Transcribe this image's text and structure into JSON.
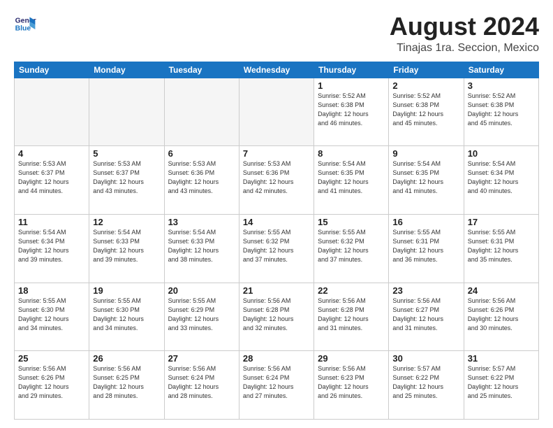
{
  "header": {
    "logo_line1": "General",
    "logo_line2": "Blue",
    "month": "August 2024",
    "location": "Tinajas 1ra. Seccion, Mexico"
  },
  "days_of_week": [
    "Sunday",
    "Monday",
    "Tuesday",
    "Wednesday",
    "Thursday",
    "Friday",
    "Saturday"
  ],
  "weeks": [
    [
      {
        "day": "",
        "info": ""
      },
      {
        "day": "",
        "info": ""
      },
      {
        "day": "",
        "info": ""
      },
      {
        "day": "",
        "info": ""
      },
      {
        "day": "1",
        "info": "Sunrise: 5:52 AM\nSunset: 6:38 PM\nDaylight: 12 hours\nand 46 minutes."
      },
      {
        "day": "2",
        "info": "Sunrise: 5:52 AM\nSunset: 6:38 PM\nDaylight: 12 hours\nand 45 minutes."
      },
      {
        "day": "3",
        "info": "Sunrise: 5:52 AM\nSunset: 6:38 PM\nDaylight: 12 hours\nand 45 minutes."
      }
    ],
    [
      {
        "day": "4",
        "info": "Sunrise: 5:53 AM\nSunset: 6:37 PM\nDaylight: 12 hours\nand 44 minutes."
      },
      {
        "day": "5",
        "info": "Sunrise: 5:53 AM\nSunset: 6:37 PM\nDaylight: 12 hours\nand 43 minutes."
      },
      {
        "day": "6",
        "info": "Sunrise: 5:53 AM\nSunset: 6:36 PM\nDaylight: 12 hours\nand 43 minutes."
      },
      {
        "day": "7",
        "info": "Sunrise: 5:53 AM\nSunset: 6:36 PM\nDaylight: 12 hours\nand 42 minutes."
      },
      {
        "day": "8",
        "info": "Sunrise: 5:54 AM\nSunset: 6:35 PM\nDaylight: 12 hours\nand 41 minutes."
      },
      {
        "day": "9",
        "info": "Sunrise: 5:54 AM\nSunset: 6:35 PM\nDaylight: 12 hours\nand 41 minutes."
      },
      {
        "day": "10",
        "info": "Sunrise: 5:54 AM\nSunset: 6:34 PM\nDaylight: 12 hours\nand 40 minutes."
      }
    ],
    [
      {
        "day": "11",
        "info": "Sunrise: 5:54 AM\nSunset: 6:34 PM\nDaylight: 12 hours\nand 39 minutes."
      },
      {
        "day": "12",
        "info": "Sunrise: 5:54 AM\nSunset: 6:33 PM\nDaylight: 12 hours\nand 39 minutes."
      },
      {
        "day": "13",
        "info": "Sunrise: 5:54 AM\nSunset: 6:33 PM\nDaylight: 12 hours\nand 38 minutes."
      },
      {
        "day": "14",
        "info": "Sunrise: 5:55 AM\nSunset: 6:32 PM\nDaylight: 12 hours\nand 37 minutes."
      },
      {
        "day": "15",
        "info": "Sunrise: 5:55 AM\nSunset: 6:32 PM\nDaylight: 12 hours\nand 37 minutes."
      },
      {
        "day": "16",
        "info": "Sunrise: 5:55 AM\nSunset: 6:31 PM\nDaylight: 12 hours\nand 36 minutes."
      },
      {
        "day": "17",
        "info": "Sunrise: 5:55 AM\nSunset: 6:31 PM\nDaylight: 12 hours\nand 35 minutes."
      }
    ],
    [
      {
        "day": "18",
        "info": "Sunrise: 5:55 AM\nSunset: 6:30 PM\nDaylight: 12 hours\nand 34 minutes."
      },
      {
        "day": "19",
        "info": "Sunrise: 5:55 AM\nSunset: 6:30 PM\nDaylight: 12 hours\nand 34 minutes."
      },
      {
        "day": "20",
        "info": "Sunrise: 5:55 AM\nSunset: 6:29 PM\nDaylight: 12 hours\nand 33 minutes."
      },
      {
        "day": "21",
        "info": "Sunrise: 5:56 AM\nSunset: 6:28 PM\nDaylight: 12 hours\nand 32 minutes."
      },
      {
        "day": "22",
        "info": "Sunrise: 5:56 AM\nSunset: 6:28 PM\nDaylight: 12 hours\nand 31 minutes."
      },
      {
        "day": "23",
        "info": "Sunrise: 5:56 AM\nSunset: 6:27 PM\nDaylight: 12 hours\nand 31 minutes."
      },
      {
        "day": "24",
        "info": "Sunrise: 5:56 AM\nSunset: 6:26 PM\nDaylight: 12 hours\nand 30 minutes."
      }
    ],
    [
      {
        "day": "25",
        "info": "Sunrise: 5:56 AM\nSunset: 6:26 PM\nDaylight: 12 hours\nand 29 minutes."
      },
      {
        "day": "26",
        "info": "Sunrise: 5:56 AM\nSunset: 6:25 PM\nDaylight: 12 hours\nand 28 minutes."
      },
      {
        "day": "27",
        "info": "Sunrise: 5:56 AM\nSunset: 6:24 PM\nDaylight: 12 hours\nand 28 minutes."
      },
      {
        "day": "28",
        "info": "Sunrise: 5:56 AM\nSunset: 6:24 PM\nDaylight: 12 hours\nand 27 minutes."
      },
      {
        "day": "29",
        "info": "Sunrise: 5:56 AM\nSunset: 6:23 PM\nDaylight: 12 hours\nand 26 minutes."
      },
      {
        "day": "30",
        "info": "Sunrise: 5:57 AM\nSunset: 6:22 PM\nDaylight: 12 hours\nand 25 minutes."
      },
      {
        "day": "31",
        "info": "Sunrise: 5:57 AM\nSunset: 6:22 PM\nDaylight: 12 hours\nand 25 minutes."
      }
    ]
  ]
}
